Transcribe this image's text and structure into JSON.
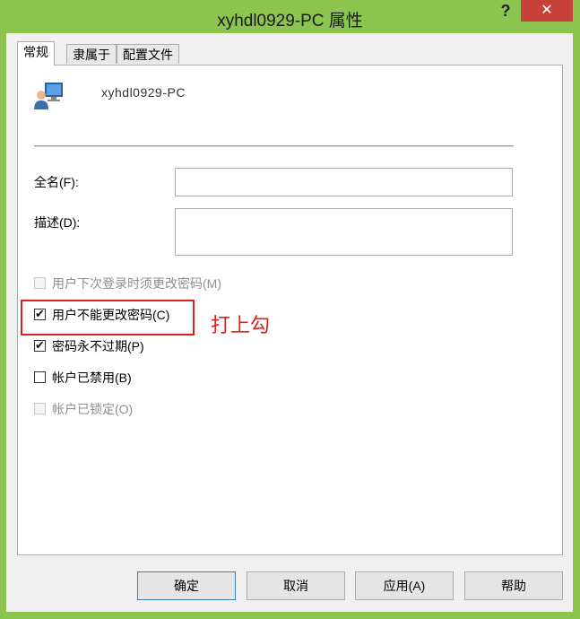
{
  "window": {
    "title": "xyhdl0929-PC 属性",
    "help_glyph": "?",
    "close_glyph": "✕"
  },
  "tabs": [
    {
      "label": "常规"
    },
    {
      "label": "隶属于"
    },
    {
      "label": "配置文件"
    }
  ],
  "general": {
    "computer_name": "xyhdl0929-PC",
    "fullname_label": "全名(F):",
    "fullname_value": "",
    "description_label": "描述(D):",
    "description_value": ""
  },
  "options": [
    {
      "label": "用户下次登录时须更改密码(M)",
      "checked": false,
      "enabled": false
    },
    {
      "label": "用户不能更改密码(C)",
      "checked": true,
      "enabled": true
    },
    {
      "label": "密码永不过期(P)",
      "checked": true,
      "enabled": true
    },
    {
      "label": "帐户已禁用(B)",
      "checked": false,
      "enabled": true
    },
    {
      "label": "帐户已锁定(O)",
      "checked": false,
      "enabled": false
    }
  ],
  "annotation": {
    "text": "打上勾",
    "color": "#e02020"
  },
  "buttons": {
    "ok": "确定",
    "cancel": "取消",
    "apply": "应用(A)",
    "help": "帮助"
  },
  "colors": {
    "window_frame": "#8cc44f",
    "close_button": "#c7403a"
  },
  "icons": {
    "user_icon": "computer-user-icon"
  }
}
